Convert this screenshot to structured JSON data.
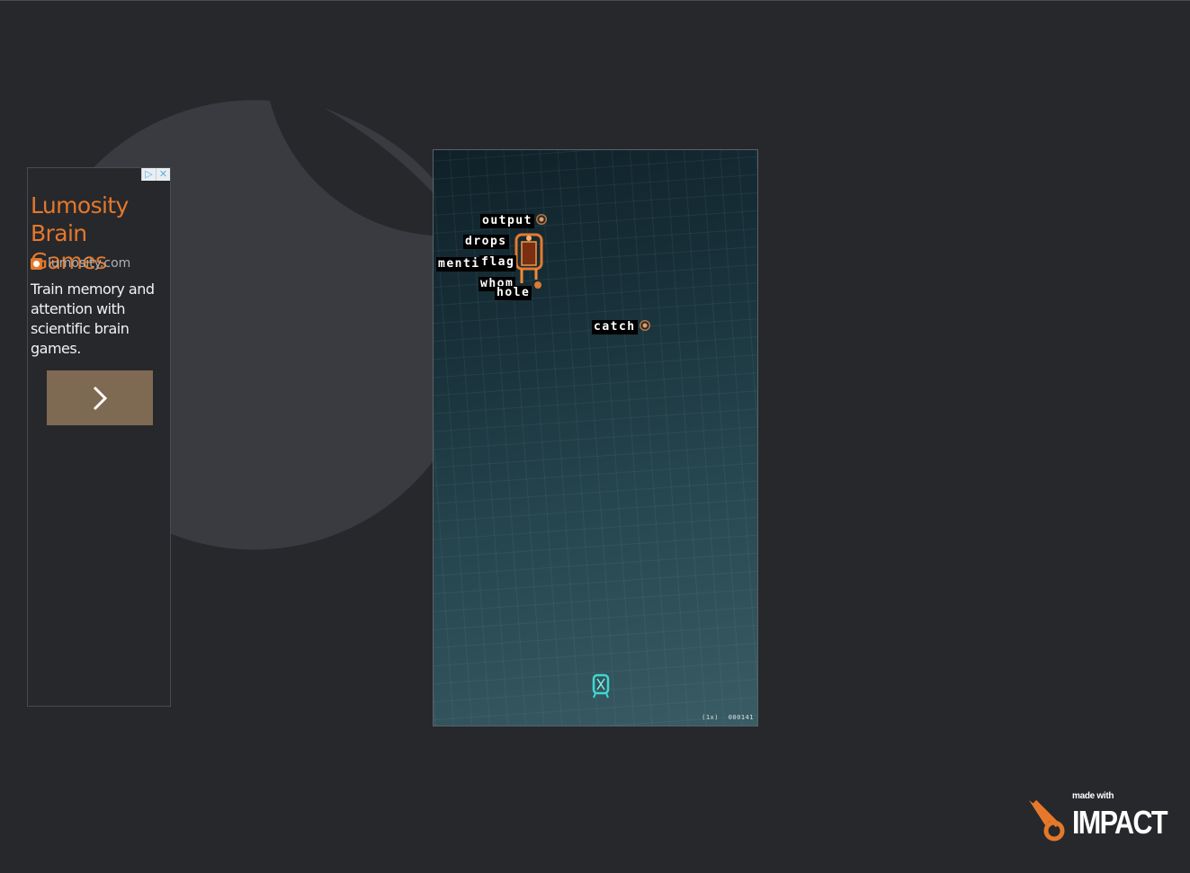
{
  "ad": {
    "title": "Lumosity Brain Games",
    "source_url": "lumosity.com",
    "body": "Train memory and attention with scientific brain games.",
    "choices_icon": "play-triangle-icon",
    "close_icon": "close-icon",
    "cta_icon": "chevron-right-icon",
    "title_color": "#e5782a",
    "cta_color": "#7e6a52"
  },
  "game": {
    "words": [
      "output",
      "drops",
      "mentioned",
      "flag",
      "whom",
      "hole",
      "catch"
    ],
    "hud": {
      "multiplier": "(1x)",
      "score": "000141"
    }
  },
  "branding": {
    "made_with": "made with",
    "name": "IMPACT",
    "accent_color": "#e5782a"
  }
}
